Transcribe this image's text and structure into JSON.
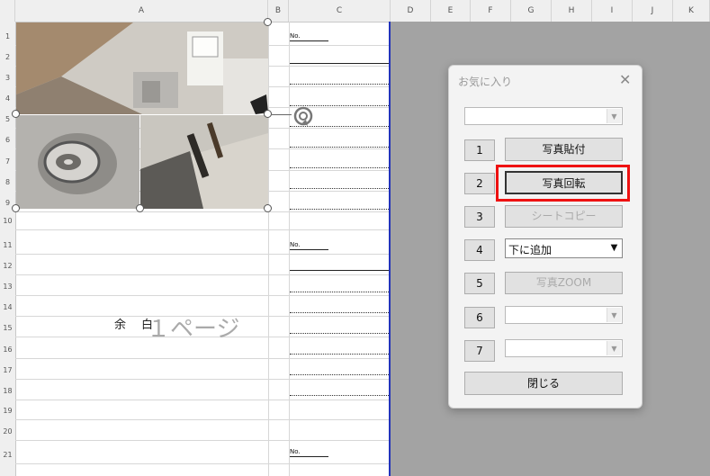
{
  "columns": [
    "A",
    "B",
    "C",
    "D",
    "E",
    "F",
    "G",
    "H",
    "I",
    "J",
    "K"
  ],
  "rows": [
    "1",
    "2",
    "3",
    "4",
    "5",
    "6",
    "7",
    "8",
    "9",
    "10",
    "11",
    "12",
    "13",
    "14",
    "15",
    "16",
    "17",
    "18",
    "19",
    "20",
    "21"
  ],
  "sheet": {
    "margin_label": "余　白",
    "page_label": "１ページ",
    "ruler_tick": "No."
  },
  "dialog": {
    "title": "お気に入り",
    "close_glyph": "✕",
    "top_combo_value": "",
    "buttons": [
      {
        "num": "1",
        "label": "写真貼付",
        "enabled": true
      },
      {
        "num": "2",
        "label": "写真回転",
        "enabled": true
      },
      {
        "num": "3",
        "label": "シートコピー",
        "enabled": false
      },
      {
        "num": "4",
        "label": "下に追加",
        "enabled": true
      },
      {
        "num": "5",
        "label": "写真ZOOM",
        "enabled": false
      },
      {
        "num": "6",
        "label": "",
        "enabled": false
      },
      {
        "num": "7",
        "label": "",
        "enabled": false
      }
    ],
    "close_label": "閉じる"
  },
  "colors": {
    "highlight": "#ee1111",
    "page_border": "#2233bb"
  }
}
